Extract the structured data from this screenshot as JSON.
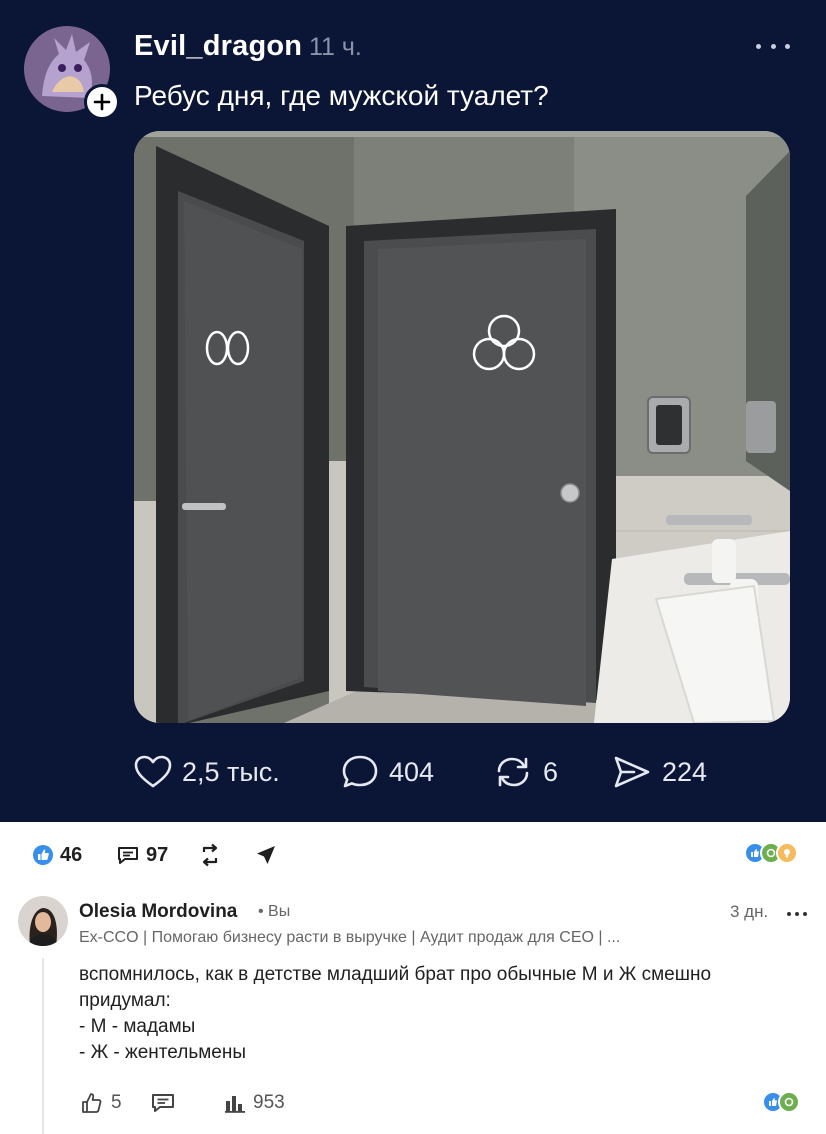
{
  "post": {
    "username": "Evil_dragon",
    "time": "11 ч.",
    "text": "Ребус дня, где мужской туалет?",
    "photo_alt": "",
    "stats": {
      "likes": "2,5 тыс.",
      "comments": "404",
      "reposts": "6",
      "shares": "224"
    },
    "colors": {
      "background": "#0b1535",
      "text": "#ffffff",
      "muted": "#8a93ab"
    }
  },
  "linkedin_bar": {
    "reactions_count": "46",
    "comments_count": "97"
  },
  "comment": {
    "author": "Olesia Mordovina",
    "you_badge": "• Вы",
    "time": "3 дн.",
    "headline": "Ex-CCO | Помогаю бизнесу расти в выручке | Аудит продаж для CEO | ...",
    "lines": [
      "вспомнилось, как в детстве младший брат про обычные М и Ж смешно",
      "придумал:",
      "- М - мадамы",
      "- Ж - жентельмены"
    ],
    "likes": "5",
    "views": "953"
  },
  "icons": {
    "like": "heart-icon",
    "comment": "speech-bubble-icon",
    "repost": "repost-icon",
    "share": "paper-plane-icon"
  }
}
